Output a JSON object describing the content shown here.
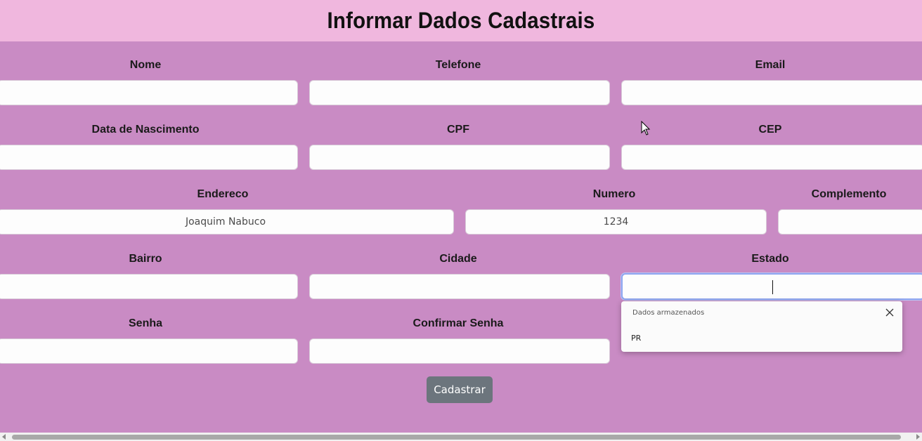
{
  "header": {
    "title": "Informar Dados Cadastrais"
  },
  "form": {
    "nome": {
      "label": "Nome",
      "value": ""
    },
    "telefone": {
      "label": "Telefone",
      "value": ""
    },
    "email": {
      "label": "Email",
      "value": ""
    },
    "data_nascimento": {
      "label": "Data de Nascimento",
      "value": ""
    },
    "cpf": {
      "label": "CPF",
      "value": ""
    },
    "cep": {
      "label": "CEP",
      "value": ""
    },
    "endereco": {
      "label": "Endereco",
      "value": "Joaquim Nabuco"
    },
    "numero": {
      "label": "Numero",
      "value": "1234"
    },
    "complemento": {
      "label": "Complemento",
      "value": ""
    },
    "bairro": {
      "label": "Bairro",
      "value": ""
    },
    "cidade": {
      "label": "Cidade",
      "value": ""
    },
    "estado": {
      "label": "Estado",
      "value": ""
    },
    "senha": {
      "label": "Senha",
      "value": ""
    },
    "confirmar_senha": {
      "label": "Confirmar Senha",
      "value": ""
    },
    "submit_label": "Cadastrar"
  },
  "autofill": {
    "header": "Dados armazenados",
    "items": [
      "PR"
    ]
  },
  "colors": {
    "page_bg": "#c98bc4",
    "header_bg": "#f0b7de",
    "button_bg": "#6c757d",
    "focus_ring": "#8fa4ef"
  }
}
